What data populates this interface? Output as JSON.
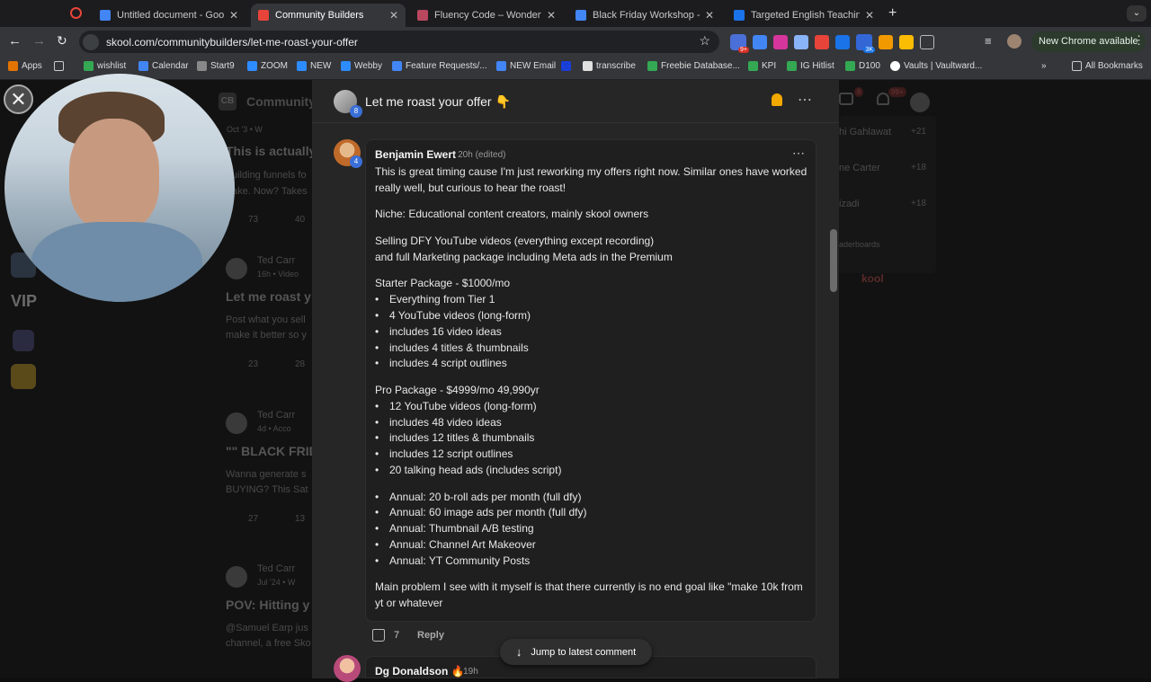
{
  "browser": {
    "tabs": [
      {
        "title": "Untitled document - Google D",
        "color": "#4285f4"
      },
      {
        "title": "Community Builders",
        "color": "#e8443a"
      },
      {
        "title": "Fluency Code – Wonderful W",
        "color": "#b9475e"
      },
      {
        "title": "Black Friday Workshop - Goo",
        "color": "#4285f4"
      },
      {
        "title": "Targeted English Teaching for",
        "color": "#1a73e8"
      }
    ],
    "url": "skool.com/communitybuilders/let-me-roast-your-offer",
    "update_label": "New Chrome available",
    "extension_badge_1": "9+",
    "extension_badge_2": "3K",
    "bookmarks": [
      {
        "label": "Apps",
        "color": "#e37400"
      },
      {
        "label": "wishlist",
        "color": "#34a853"
      },
      {
        "label": "Calendar",
        "color": "#4285f4"
      },
      {
        "label": "Start9",
        "color": "#888888"
      },
      {
        "label": "ZOOM",
        "color": "#2d8cff"
      },
      {
        "label": "NEW",
        "color": "#2d8cff"
      },
      {
        "label": "Webby",
        "color": "#2d8cff"
      },
      {
        "label": "Feature Requests/...",
        "color": "#4285f4"
      },
      {
        "label": "NEW Email",
        "color": "#4285f4"
      },
      {
        "label": "transcribe",
        "color": "#e0e0e0"
      },
      {
        "label": "Freebie Database...",
        "color": "#34a853"
      },
      {
        "label": "KPI",
        "color": "#34a853"
      },
      {
        "label": "IG Hitlist",
        "color": "#34a853"
      },
      {
        "label": "D100",
        "color": "#34a853"
      },
      {
        "label": "Vaults | Vaultward...",
        "color": "#ffffff"
      }
    ],
    "all_bookmarks": "All Bookmarks"
  },
  "background": {
    "community_name": "Community",
    "logo": "CB",
    "vip": "VIP",
    "posts": [
      {
        "author": "",
        "meta": "Oct '3 • W",
        "title": "This is actually",
        "excerpt1": "uilding funnels fo",
        "excerpt2": "ake. Now? Takes",
        "likes": "73",
        "comments": "40"
      },
      {
        "author": "Ted Carr",
        "meta": "16h • Video",
        "title": "Let me roast y",
        "excerpt1": "Post what you sell",
        "excerpt2": "make it better so y",
        "likes": "23",
        "comments": "28"
      },
      {
        "author": "Ted Carr",
        "meta": "4d • Acco",
        "title": "\"\" BLACK FRID",
        "excerpt1": "Wanna generate s",
        "excerpt2": "BUYING? This Sat",
        "likes": "27",
        "comments": "13"
      },
      {
        "author": "Ted Carr",
        "meta": "Jul '24 • W",
        "title": "POV: Hitting y",
        "excerpt1": "@Samuel Earp jus",
        "excerpt2": "channel, a free Sko",
        "likes": "",
        "comments": ""
      }
    ],
    "leaderboard": [
      {
        "name": "hi Gahlawat",
        "points": "+21"
      },
      {
        "name": "ne Carter",
        "points": "+18"
      },
      {
        "name": "izadi",
        "points": "+18"
      }
    ],
    "leaderboards_link": "aderboards",
    "powered": "kool",
    "notif_count": "8",
    "chat_count": "99+"
  },
  "modal": {
    "title": "Let me roast your offer 👇",
    "author_level": "8"
  },
  "comment": {
    "author": "Benjamin Ewert",
    "meta": "· 20h (edited)",
    "level": "4",
    "p1": "This is great timing cause I'm just reworking my offers right now. Similar ones have worked really well, but curious to hear the roast!",
    "p2": "Niche: Educational content creators, mainly skool owners",
    "p3a": "Selling DFY YouTube videos (everything except recording)",
    "p3b": "and full Marketing package including Meta ads in the Premium",
    "starter_title": "Starter Package - $1000/mo",
    "starter_items": [
      "Everything from Tier 1",
      "4 YouTube videos (long-form)",
      "includes 16 video ideas",
      "includes 4 titles & thumbnails",
      "includes 4 script outlines"
    ],
    "pro_title": "Pro Package - $4999/mo 49,990yr",
    "pro_items": [
      "12 YouTube videos (long-form)",
      "includes 48 video ideas",
      "includes 12 titles & thumbnails",
      "includes 12 script outlines",
      "20 talking head ads (includes script)"
    ],
    "annual_items": [
      "Annual: 20 b-roll ads per month (full dfy)",
      "Annual: 60 image ads per month (full dfy)",
      "Annual: Thumbnail A/B testing",
      "Annual: Channel Art Makeover",
      "Annual: YT Community Posts"
    ],
    "p_last": "Main problem I see with it myself is that there currently is no end goal like \"make 10k from yt or whatever",
    "likes": "7",
    "reply": "Reply"
  },
  "next_comment": {
    "author": "Dg Donaldson 🔥",
    "meta": "· 19h"
  },
  "jump_label": "Jump to latest comment"
}
